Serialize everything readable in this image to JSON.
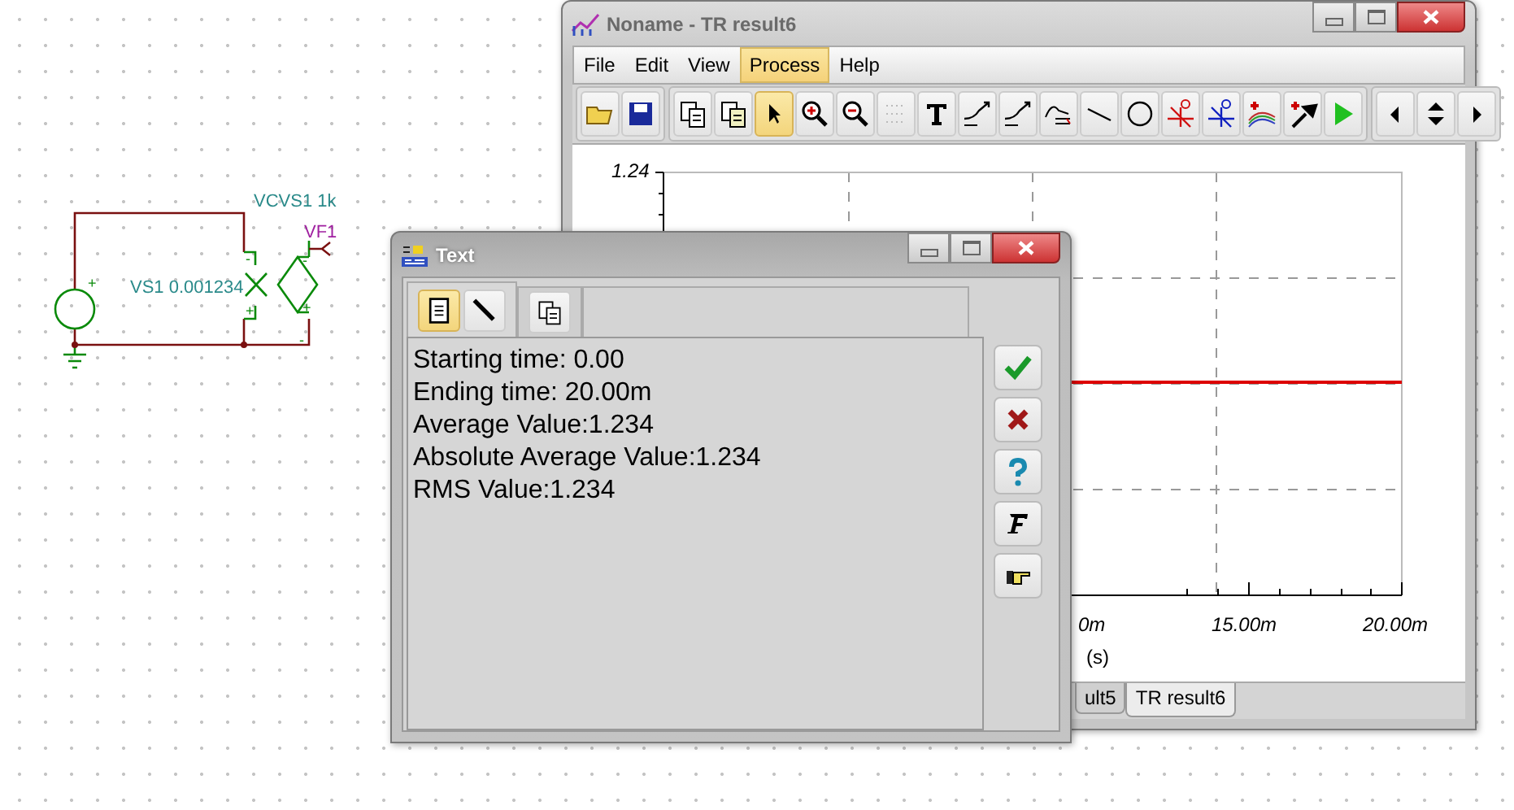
{
  "schematic": {
    "labels": [
      {
        "kind": "component",
        "text": "VCVS1 1k"
      },
      {
        "kind": "probe",
        "text": "VF1"
      },
      {
        "kind": "component",
        "text": "VS1 0.001234"
      }
    ],
    "signs": [
      "+",
      "-",
      "+",
      "-",
      "+",
      "-"
    ]
  },
  "result_window": {
    "title": "Noname - TR result6",
    "menu": [
      {
        "label": "File",
        "selected": false
      },
      {
        "label": "Edit",
        "selected": false
      },
      {
        "label": "View",
        "selected": false
      },
      {
        "label": "Process",
        "selected": true
      },
      {
        "label": "Help",
        "selected": false
      }
    ],
    "toolbar": [
      {
        "kind": "open",
        "selected": false
      },
      {
        "kind": "save",
        "selected": false
      },
      {
        "kind": "copy",
        "selected": false
      },
      {
        "kind": "paste",
        "selected": false
      },
      {
        "kind": "pointer",
        "selected": true
      },
      {
        "kind": "zoom-in",
        "selected": false
      },
      {
        "kind": "zoom-out",
        "selected": false
      },
      {
        "kind": "grid",
        "selected": false
      },
      {
        "kind": "text",
        "selected": false
      },
      {
        "kind": "curve-text",
        "selected": false
      },
      {
        "kind": "curve-query",
        "selected": false
      },
      {
        "kind": "curve-list",
        "selected": false
      },
      {
        "kind": "line",
        "selected": false
      },
      {
        "kind": "circle",
        "selected": false
      },
      {
        "kind": "cursor-a",
        "selected": false
      },
      {
        "kind": "cursor-b",
        "selected": false
      },
      {
        "kind": "add-curves",
        "selected": false
      },
      {
        "kind": "pick",
        "selected": false
      },
      {
        "kind": "run",
        "selected": false
      },
      {
        "kind": "left",
        "selected": false
      },
      {
        "kind": "updown",
        "selected": false
      },
      {
        "kind": "right",
        "selected": false
      }
    ],
    "chart": {
      "y_tick": "1.24",
      "x_ticks": [
        "0m",
        "15.00m",
        "20.00m"
      ],
      "xlabel": "(s)"
    },
    "tabs": [
      {
        "label": "ult5",
        "selected": false
      },
      {
        "label": "TR result6",
        "selected": true
      }
    ]
  },
  "text_window": {
    "title": "Text",
    "tabs": [
      {
        "selected": true,
        "buttons": [
          {
            "kind": "page",
            "selected": true
          },
          {
            "kind": "pen",
            "selected": false
          }
        ]
      },
      {
        "selected": false,
        "buttons": [
          {
            "kind": "copy",
            "selected": false
          }
        ]
      }
    ],
    "lines": [
      "Starting time: 0.00",
      "Ending time: 20.00m",
      "Average Value:1.234",
      "Absolute Average Value:1.234",
      "RMS Value:1.234"
    ],
    "side_buttons": [
      {
        "kind": "ok"
      },
      {
        "kind": "cancel"
      },
      {
        "kind": "help"
      },
      {
        "kind": "font"
      },
      {
        "kind": "point"
      }
    ]
  }
}
